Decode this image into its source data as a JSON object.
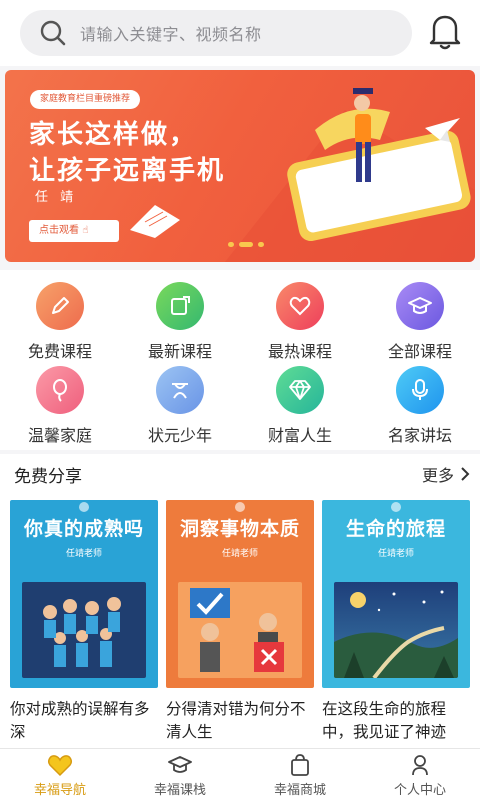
{
  "search": {
    "placeholder": "请输入关键字、视频名称"
  },
  "banner": {
    "tag": "家庭教育栏目重磅推荐",
    "title_line1": "家长这样做，",
    "title_line2": "让孩子远离手机",
    "author": "任 靖",
    "cta": "点击观看"
  },
  "categories": [
    {
      "label": "免费课程",
      "icon": "pencil-icon",
      "color": "#f08a5d"
    },
    {
      "label": "最新课程",
      "icon": "new-badge-icon",
      "color": "#4cc86a"
    },
    {
      "label": "最热课程",
      "icon": "heart-icon",
      "color": "#f0524e"
    },
    {
      "label": "全部课程",
      "icon": "graduation-cap-icon",
      "color": "#7b68e8"
    },
    {
      "label": "温馨家庭",
      "icon": "balloon-icon",
      "color": "#f06d80"
    },
    {
      "label": "状元少年",
      "icon": "scholar-icon",
      "color": "#7aa7e8"
    },
    {
      "label": "财富人生",
      "icon": "diamond-icon",
      "color": "#39c9a0"
    },
    {
      "label": "名家讲坛",
      "icon": "microphone-icon",
      "color": "#2fa6f0"
    }
  ],
  "section": {
    "title": "免费分享",
    "more": "更多"
  },
  "cards": [
    {
      "heading": "你真的成熟吗",
      "teacher": "任靖老师",
      "description": "你对成熟的误解有多深",
      "color": "#29a3d6"
    },
    {
      "heading": "洞察事物本质",
      "teacher": "任靖老师",
      "description": "分得清对错为何分不清人生",
      "color": "#ee7b3c"
    },
    {
      "heading": "生命的旅程",
      "teacher": "任靖老师",
      "description": "在这段生命的旅程中，我见证了神迹",
      "color": "#3bb7de"
    }
  ],
  "nav": [
    {
      "label": "幸福导航",
      "icon": "heart-nav-icon",
      "active": true
    },
    {
      "label": "幸福课栈",
      "icon": "cap-nav-icon",
      "active": false
    },
    {
      "label": "幸福商城",
      "icon": "bag-nav-icon",
      "active": false
    },
    {
      "label": "个人中心",
      "icon": "user-nav-icon",
      "active": false
    }
  ],
  "colors": {
    "accent": "#d79b12",
    "banner": "#f1603e"
  }
}
